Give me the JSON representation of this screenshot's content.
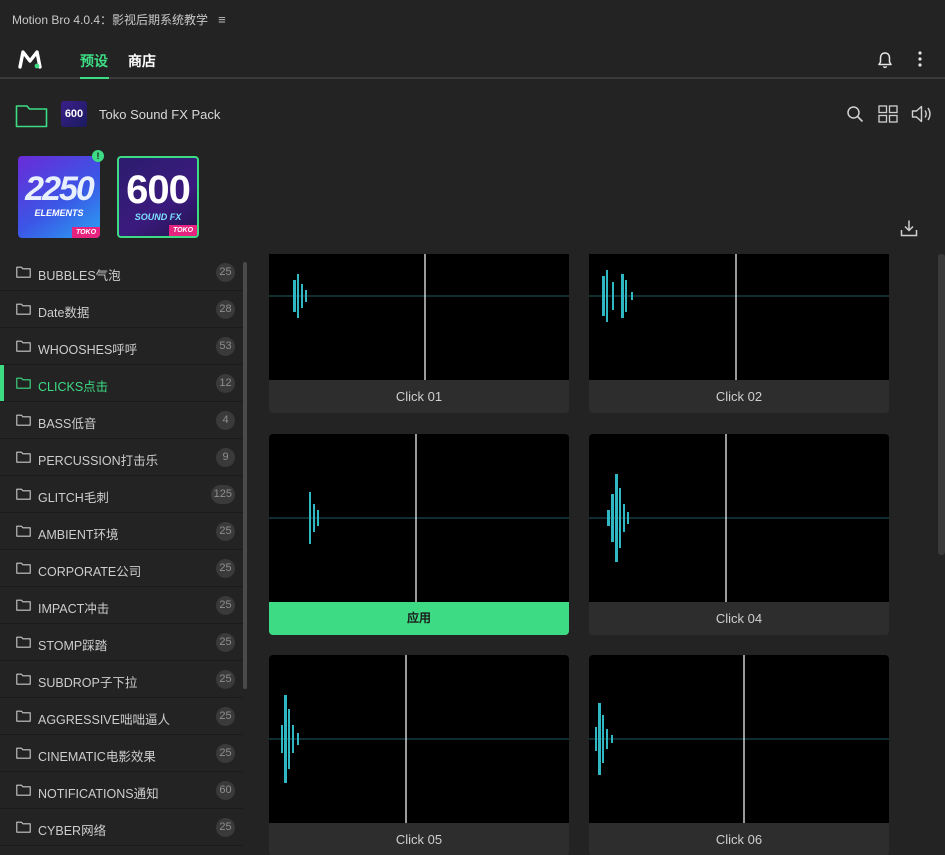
{
  "window": {
    "title": "Motion Bro 4.0.4：影视后期系统教学",
    "menu_glyph": "≡"
  },
  "nav": {
    "tabs": [
      {
        "label": "预设",
        "active": true
      },
      {
        "label": "商店",
        "active": false
      }
    ]
  },
  "pack_header": {
    "thumb_label": "600",
    "pack_name": "Toko Sound FX Pack"
  },
  "packs": [
    {
      "number": "2250",
      "subtitle": "ELEMENTS",
      "brand": "TOKO",
      "alert": "!"
    },
    {
      "number": "600",
      "subtitle": "SOUND FX",
      "brand": "TOKO",
      "selected": true
    }
  ],
  "categories": [
    {
      "label": "BUBBLES气泡",
      "count": "25"
    },
    {
      "label": "Date数据",
      "count": "28"
    },
    {
      "label": "WHOOSHES呼呼",
      "count": "53"
    },
    {
      "label": "CLICKS点击",
      "count": "12",
      "active": true
    },
    {
      "label": "BASS低音",
      "count": "4"
    },
    {
      "label": "PERCUSSION打击乐",
      "count": "9"
    },
    {
      "label": "GLITCH毛刺",
      "count": "125"
    },
    {
      "label": "AMBIENT环境",
      "count": "25"
    },
    {
      "label": "CORPORATE公司",
      "count": "25"
    },
    {
      "label": "IMPACT冲击",
      "count": "25"
    },
    {
      "label": "STOMP踩踏",
      "count": "25"
    },
    {
      "label": "SUBDROP子下拉",
      "count": "25"
    },
    {
      "label": "AGGRESSIVE咄咄逼人",
      "count": "25"
    },
    {
      "label": "CINEMATIC电影效果",
      "count": "25"
    },
    {
      "label": "NOTIFICATIONS通知",
      "count": "60"
    },
    {
      "label": "CYBER网络",
      "count": "25"
    }
  ],
  "presets": [
    {
      "label": "Click 01"
    },
    {
      "label": "Click 02"
    },
    {
      "label": "应用",
      "hovered": true
    },
    {
      "label": "Click 04"
    },
    {
      "label": "Click 05"
    },
    {
      "label": "Click 06"
    }
  ],
  "colors": {
    "accent": "#3ddc84",
    "waveform": "#2fb7c4",
    "background": "#232323"
  }
}
